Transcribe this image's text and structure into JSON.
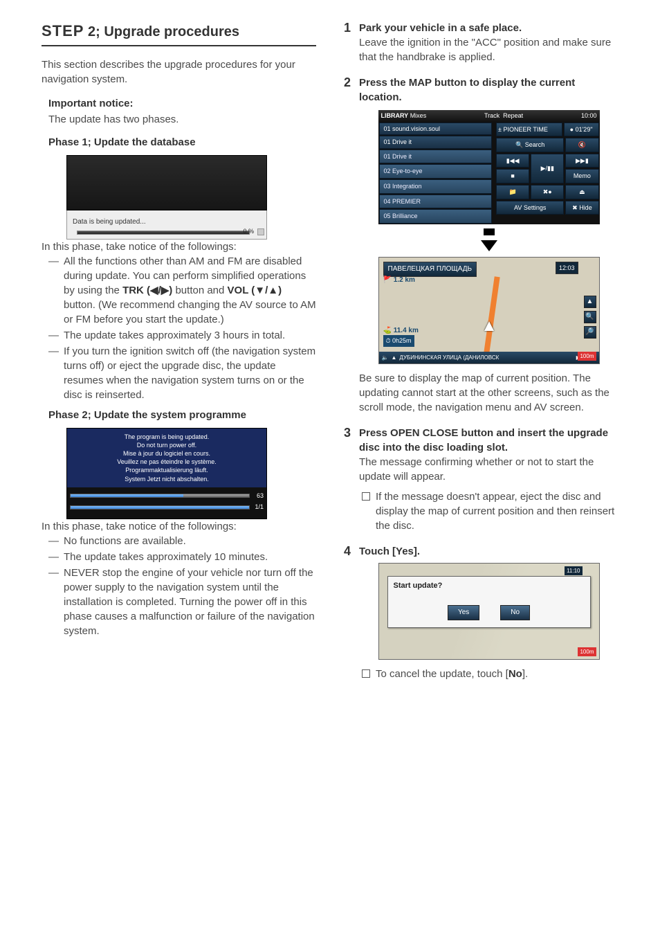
{
  "header": {
    "step_word": "STEP",
    "step_rest": " 2; Upgrade procedures"
  },
  "left": {
    "intro": "This section describes the upgrade procedures for your navigation system.",
    "important_heading": "Important notice:",
    "important_body": "The update has two phases.",
    "phase1_heading": "Phase 1; Update the database",
    "fig1": {
      "caption": "Data is being updated...",
      "percent": "0 %"
    },
    "phase1_note_intro": "In this phase, take notice of the followings:",
    "phase1_bullets": {
      "b1a": "All the functions other than AM and FM are disabled during update. You can perform simplified operations by using the ",
      "b1_trk": "TRK (◀/▶)",
      "b1_mid": " button and ",
      "b1_vol": "VOL (▼/▲)",
      "b1b": " button. (We recommend changing the AV source to AM or FM before you start the update.)",
      "b2": "The update takes approximately 3 hours in total.",
      "b3": "If you turn the ignition switch off (the navigation system turns off) or eject the upgrade disc, the update resumes when the navigation system turns on or the disc is reinserted."
    },
    "phase2_heading": "Phase 2; Update the system programme",
    "fig2": {
      "l1": "The program is being updated.",
      "l2": "Do not turn power off.",
      "l3": "Mise à jour du logiciel en cours.",
      "l4": "Veuillez ne pas éteindre le système.",
      "l5": "Programmaktualisierung läuft.",
      "l6": "System Jetzt nicht abschalten.",
      "p1": "63",
      "p2": "1/1"
    },
    "phase2_note_intro": "In this phase, take notice of the followings:",
    "phase2_bullets": {
      "b1": "No functions are available.",
      "b2": "The update takes approximately 10 minutes.",
      "b3": "NEVER stop the engine of your vehicle nor turn off the power supply to the navigation system until the installation is completed. Turning the power off in this phase causes a malfunction or failure of the navigation system."
    }
  },
  "right": {
    "s1_cmd": "Park your vehicle in a safe place.",
    "s1_body": "Leave the ignition in the \"ACC\" position and make sure that the handbrake is applied.",
    "s2_cmd": "Press the MAP button to display the current location.",
    "lib": {
      "title": "LIBRARY",
      "sub": "Mixes",
      "track": "Track",
      "repeat": "Repeat",
      "time": "10:00",
      "group": "01 sound.vision.soul",
      "now": "01 Drive it",
      "pioneer": "PIONEER TIME",
      "elapsed": "01'29\"",
      "items": [
        "01 Drive it",
        "02 Eye-to-eye",
        "03 Integration",
        "04 PREMIER",
        "05 Brilliance"
      ],
      "search": "Search",
      "memo": "Memo",
      "av": "AV Settings",
      "hide": "Hide"
    },
    "map": {
      "topbar": "ПАВЕЛЕЦКАЯ ПЛОЩАДЬ",
      "time": "12:03",
      "dist": "1.2 km",
      "eta_dist": "11.4 km",
      "eta_time": "0h25m",
      "bottom": "ДУБИНИНСКАЯ УЛИЦА (ДАНИЛОВСК",
      "scale": "100m"
    },
    "s2_after": "Be sure to display the map of current position. The updating cannot start at the other screens, such as the scroll mode, the navigation menu and AV screen.",
    "s3_cmd": "Press OPEN CLOSE button and insert the upgrade disc into the disc loading slot.",
    "s3_body": "The message confirming whether or not to start the update will appear.",
    "s3_note": "If the message doesn't appear, eject the disc and display the map of current position and then reinsert the disc.",
    "s4_cmd": "Touch [Yes].",
    "confirm": {
      "q": "Start update?",
      "yes": "Yes",
      "no": "No",
      "time": "11:10",
      "scale": "100m"
    },
    "s4_after_a": "To cancel the update, touch [",
    "s4_after_no": "No",
    "s4_after_b": "]."
  }
}
